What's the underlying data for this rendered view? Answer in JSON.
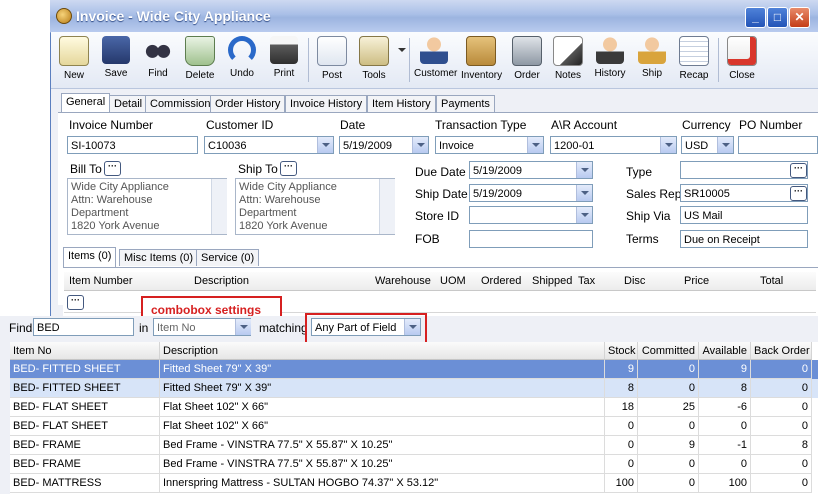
{
  "window": {
    "title": "Invoice - Wide City Appliance"
  },
  "toolbar": {
    "items": [
      "New",
      "Save",
      "Find",
      "Delete",
      "Undo",
      "Print",
      "Post",
      "Tools",
      "Customer",
      "Inventory",
      "Order",
      "Notes",
      "History",
      "Ship",
      "Recap",
      "Close"
    ]
  },
  "tabs": [
    "General",
    "Detail",
    "Commission",
    "Order History",
    "Invoice History",
    "Item History",
    "Payments"
  ],
  "form": {
    "invoice_number_label": "Invoice Number",
    "invoice_number": "SI-10073",
    "customer_id_label": "Customer ID",
    "customer_id": "C10036",
    "date_label": "Date",
    "date": "5/19/2009",
    "transaction_type_label": "Transaction Type",
    "transaction_type": "Invoice",
    "ar_account_label": "A\\R Account",
    "ar_account": "1200-01",
    "currency_label": "Currency",
    "currency": "USD",
    "po_number_label": "PO Number",
    "bill_to_label": "Bill To",
    "bill_to_lines": [
      "Wide City Appliance",
      "Attn: Warehouse",
      "Department",
      "1820 York Avenue"
    ],
    "ship_to_label": "Ship To",
    "ship_to_lines": [
      "Wide City Appliance",
      "Attn: Warehouse",
      "Department",
      "1820 York Avenue"
    ],
    "due_date_label": "Due Date",
    "due_date": "5/19/2009",
    "ship_date_label": "Ship Date",
    "ship_date": "5/19/2009",
    "store_id_label": "Store ID",
    "fob_label": "FOB",
    "type_label": "Type",
    "sales_rep_label": "Sales Rep",
    "sales_rep": "SR10005",
    "ship_via_label": "Ship Via",
    "ship_via": "US Mail",
    "terms_label": "Terms",
    "terms": "Due on Receipt"
  },
  "item_tabs": [
    "Items (0)",
    "Misc Items (0)",
    "Service (0)"
  ],
  "item_grid_headers": [
    "Item Number",
    "Description",
    "Warehouse",
    "UOM",
    "Ordered",
    "Shipped",
    "Tax",
    "Disc",
    "Price",
    "Total"
  ],
  "annotation": "combobox settings",
  "find": {
    "label": "Find",
    "value": "BED",
    "in_label": "in",
    "in_value": "Item No",
    "matching_label": "matching",
    "matching_value": "Any Part of Field"
  },
  "results": {
    "headers": [
      "Item No",
      "Description",
      "Stock",
      "Committed",
      "Available",
      "Back Order"
    ],
    "rows": [
      [
        "BED- FITTED SHEET",
        "Fitted Sheet 79\" X 39\"",
        "9",
        "0",
        "9",
        "0"
      ],
      [
        "BED- FITTED SHEET",
        "Fitted Sheet 79\" X 39\"",
        "8",
        "0",
        "8",
        "0"
      ],
      [
        "BED- FLAT SHEET",
        "Flat Sheet 102\" X 66\"",
        "18",
        "25",
        "-6",
        "0"
      ],
      [
        "BED- FLAT SHEET",
        "Flat Sheet 102\" X 66\"",
        "0",
        "0",
        "0",
        "0"
      ],
      [
        "BED- FRAME",
        "Bed Frame - VINSTRA 77.5\" X 55.87\" X 10.25\"",
        "0",
        "9",
        "-1",
        "8"
      ],
      [
        "BED- FRAME",
        "Bed Frame - VINSTRA 77.5\" X 55.87\" X 10.25\"",
        "0",
        "0",
        "0",
        "0"
      ],
      [
        "BED- MATTRESS",
        "Innerspring Mattress - SULTAN HOGBO 74.37\" X 53.12\"",
        "100",
        "0",
        "100",
        "0"
      ]
    ]
  }
}
